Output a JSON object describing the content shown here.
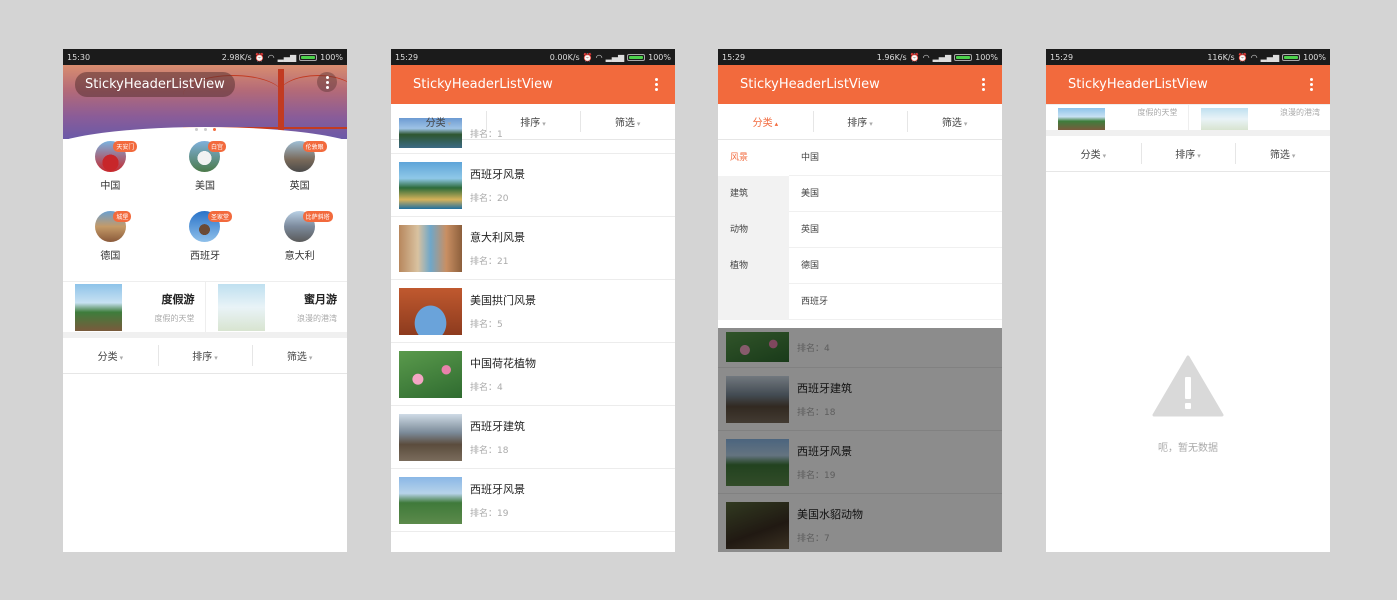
{
  "screens": [
    {
      "status": {
        "time": "15:30",
        "speed": "2.98K/s",
        "battery": "100%"
      },
      "app_title": "StickyHeaderListView",
      "carousel_dots": 3,
      "categories": [
        {
          "name": "中国",
          "badge": "天安门"
        },
        {
          "name": "美国",
          "badge": "白宫"
        },
        {
          "name": "英国",
          "badge": "伦敦眼"
        },
        {
          "name": "德国",
          "badge": "城堡"
        },
        {
          "name": "西班牙",
          "badge": "圣家堂"
        },
        {
          "name": "意大利",
          "badge": "比萨斜塔"
        }
      ],
      "promos": [
        {
          "title": "度假游",
          "subtitle": "度假的天堂"
        },
        {
          "title": "蜜月游",
          "subtitle": "浪漫的港湾"
        }
      ],
      "filter_tabs": [
        "分类",
        "排序",
        "筛选"
      ]
    },
    {
      "status": {
        "time": "15:29",
        "speed": "0.00K/s",
        "battery": "100%"
      },
      "app_title": "StickyHeaderListView",
      "filter_tabs": [
        "分类",
        "排序",
        "筛选"
      ],
      "items": [
        {
          "title": "",
          "rank": "排名：1",
          "thumb": "lake"
        },
        {
          "title": "西班牙风景",
          "rank": "排名：20",
          "thumb": "coast"
        },
        {
          "title": "意大利风景",
          "rank": "排名：21",
          "thumb": "venice"
        },
        {
          "title": "美国拱门风景",
          "rank": "排名：5",
          "thumb": "arch"
        },
        {
          "title": "中国荷花植物",
          "rank": "排名：4",
          "thumb": "lotus"
        },
        {
          "title": "西班牙建筑",
          "rank": "排名：18",
          "thumb": "spain"
        },
        {
          "title": "西班牙风景",
          "rank": "排名：19",
          "thumb": "park"
        }
      ]
    },
    {
      "status": {
        "time": "15:29",
        "speed": "1.96K/s",
        "battery": "100%"
      },
      "app_title": "StickyHeaderListView",
      "filter_tabs": [
        "分类",
        "排序",
        "筛选"
      ],
      "left_categories": [
        "风景",
        "建筑",
        "动物",
        "植物"
      ],
      "right_options": [
        "中国",
        "美国",
        "英国",
        "德国",
        "西班牙"
      ],
      "items": [
        {
          "title": "",
          "rank": "排名：4",
          "thumb": "lotus"
        },
        {
          "title": "西班牙建筑",
          "rank": "排名：18",
          "thumb": "spain"
        },
        {
          "title": "西班牙风景",
          "rank": "排名：19",
          "thumb": "park"
        },
        {
          "title": "美国水貂动物",
          "rank": "排名：7",
          "thumb": "otter"
        }
      ]
    },
    {
      "status": {
        "time": "15:29",
        "speed": "116K/s",
        "battery": "100%"
      },
      "app_title": "StickyHeaderListView",
      "promos": [
        {
          "title": "",
          "subtitle": "度假的天堂"
        },
        {
          "title": "",
          "subtitle": "浪漫的港湾"
        }
      ],
      "filter_tabs": [
        "分类",
        "排序",
        "筛选"
      ],
      "empty_text": "呃，暂无数据"
    }
  ],
  "colors": {
    "accent": "#f26a3d",
    "status_bar": "#1b1b1b",
    "page_bg": "#d4d4d4",
    "empty_icon": "#d9d9d9"
  }
}
